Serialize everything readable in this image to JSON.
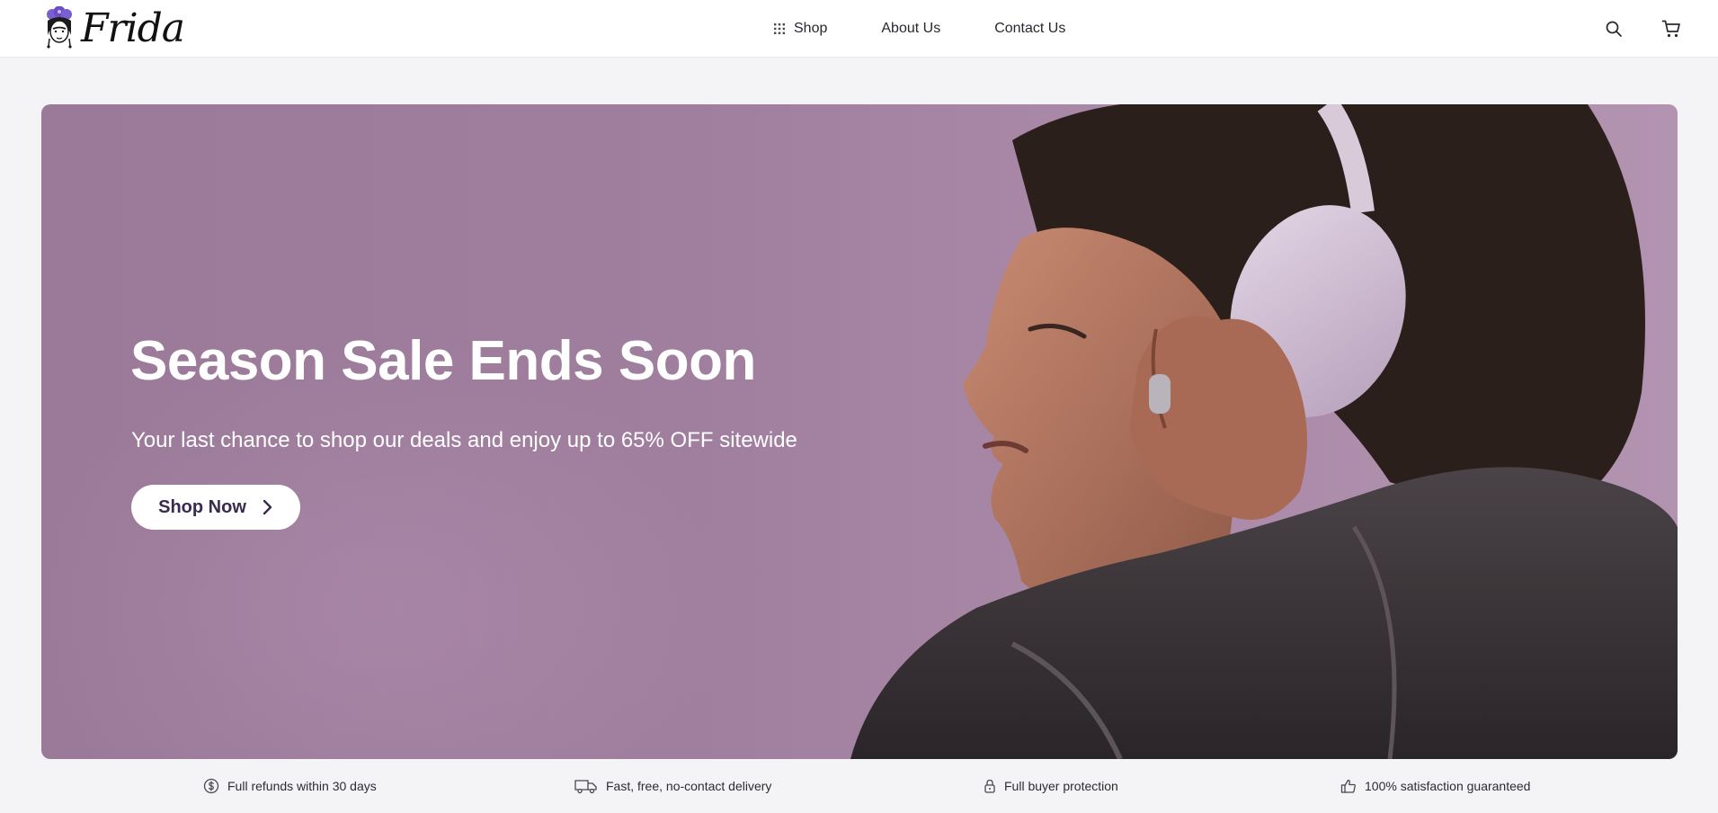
{
  "brand": {
    "name": "Frida"
  },
  "nav": {
    "items": [
      {
        "label": "Shop",
        "icon": "grid-icon"
      },
      {
        "label": "About Us"
      },
      {
        "label": "Contact Us"
      }
    ]
  },
  "header_actions": {
    "search_icon": "search-icon",
    "cart_icon": "cart-icon"
  },
  "hero": {
    "title": "Season Sale Ends Soon",
    "subtitle": "Your last chance to shop our deals and enjoy up to 65% OFF sitewide",
    "cta_label": "Shop Now",
    "cta_icon": "chevron-right-icon"
  },
  "features": [
    {
      "label": "Full refunds within 30 days",
      "icon": "dollar-circle-icon"
    },
    {
      "label": "Fast, free, no-contact delivery",
      "icon": "truck-icon"
    },
    {
      "label": "Full buyer protection",
      "icon": "lock-icon"
    },
    {
      "label": "100% satisfaction guaranteed",
      "icon": "thumbs-up-icon"
    }
  ],
  "colors": {
    "accent": "#3b2a4f",
    "hero_background": "#a07f9e",
    "page_background": "#f4f3f6"
  }
}
